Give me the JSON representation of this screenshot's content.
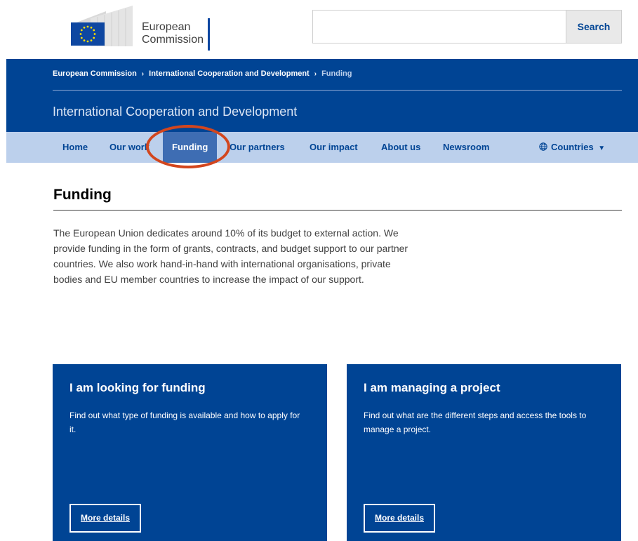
{
  "header": {
    "logo_line1": "European",
    "logo_line2": "Commission",
    "search": {
      "placeholder": "",
      "button_label": "Search"
    }
  },
  "banner": {
    "breadcrumb": [
      {
        "label": "European Commission"
      },
      {
        "label": "International Cooperation and Development"
      },
      {
        "label": "Funding"
      }
    ],
    "separator": "›",
    "site_title": "International Cooperation and Development"
  },
  "nav": {
    "items": [
      {
        "label": "Home"
      },
      {
        "label": "Our work"
      },
      {
        "label": "Funding",
        "active": true
      },
      {
        "label": "Our partners"
      },
      {
        "label": "Our impact"
      },
      {
        "label": "About us"
      },
      {
        "label": "Newsroom"
      },
      {
        "label": "Countries",
        "icon": "globe-icon",
        "dropdown": true
      }
    ],
    "dropdown_glyph": "▼"
  },
  "main": {
    "title": "Funding",
    "intro": "The European Union dedicates around 10% of its budget to external action. We provide funding in the form of grants, contracts, and budget support to our partner countries. We also work hand-in-hand with international organisations, private bodies and EU member countries to increase the impact of our support.",
    "cards": [
      {
        "title": "I am looking for funding",
        "text": "Find out what type of funding is available and how to apply for it.",
        "link": "More details"
      },
      {
        "title": "I am managing a project",
        "text": "Find out what are the different steps and access the tools to manage a project.",
        "link": "More details"
      }
    ]
  },
  "colors": {
    "primary": "#004494",
    "nav_bg": "#bcd0ec",
    "active_tab": "#3e6db3",
    "highlight": "#d2461e"
  }
}
